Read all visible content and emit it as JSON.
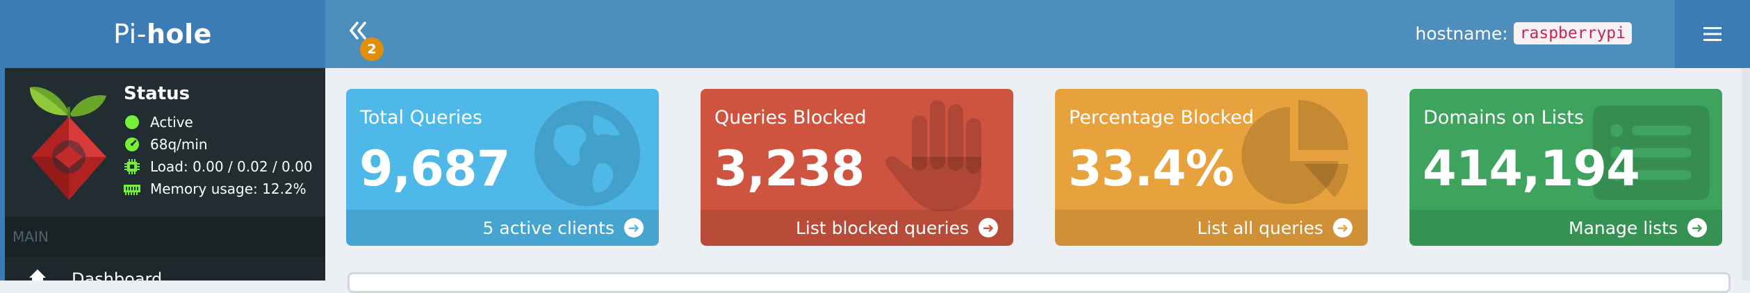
{
  "brand": {
    "prefix": "Pi-",
    "suffix": "hole"
  },
  "navbar": {
    "toggle_icon": "double-chevron-left-icon",
    "badge_count": "2",
    "hostname_label": "hostname:",
    "hostname_value": "raspberrypi",
    "menu_icon": "hamburger-menu-icon"
  },
  "sidebar": {
    "status_title": "Status",
    "status_items": [
      {
        "icon": "green-dot-icon",
        "text": "Active",
        "color": "#77f03a"
      },
      {
        "icon": "gauge-icon",
        "text": "68q/min",
        "color": "#77f03a"
      },
      {
        "icon": "cpu-chip-icon",
        "text": "Load:  0.00 / 0.02 / 0.00",
        "color": "#77f03a"
      },
      {
        "icon": "memory-icon",
        "text": "Memory usage:  12.2%",
        "color": "#77f03a"
      }
    ],
    "section_header": "MAIN",
    "nav_items": [
      {
        "label": "Dashboard",
        "icon": "home-icon"
      }
    ]
  },
  "cards": [
    {
      "title": "Total Queries",
      "value": "9,687",
      "footer": "5 active clients",
      "color": "#4eb8e8",
      "icon": "globe-icon"
    },
    {
      "title": "Queries Blocked",
      "value": "3,238",
      "footer": "List blocked queries",
      "color": "#cf5440",
      "icon": "hand-icon"
    },
    {
      "title": "Percentage Blocked",
      "value": "33.4%",
      "footer": "List all queries",
      "color": "#e8a23d",
      "icon": "pie-chart-icon"
    },
    {
      "title": "Domains on Lists",
      "value": "414,194",
      "footer": "Manage lists",
      "color": "#3da35d",
      "icon": "list-icon"
    }
  ]
}
